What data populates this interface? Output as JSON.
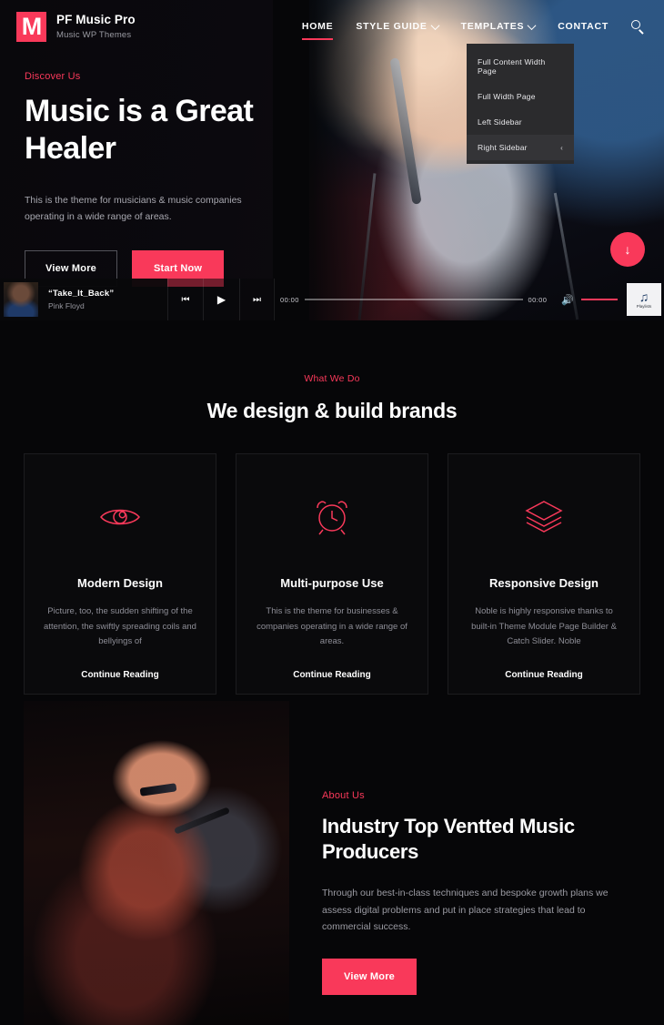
{
  "brand": {
    "logo_letter": "M",
    "title": "PF Music Pro",
    "tagline": "Music WP Themes"
  },
  "nav": {
    "items": [
      {
        "label": "HOME",
        "active": true,
        "caret": false
      },
      {
        "label": "STYLE GUIDE",
        "active": false,
        "caret": true
      },
      {
        "label": "TEMPLATES",
        "active": false,
        "caret": true
      },
      {
        "label": "CONTACT",
        "active": false,
        "caret": false
      }
    ],
    "search_icon": "search-icon"
  },
  "dropdown": {
    "items": [
      {
        "label": "Full Content Width Page",
        "active": false,
        "arrow": ""
      },
      {
        "label": "Full Width Page",
        "active": false,
        "arrow": ""
      },
      {
        "label": "Left Sidebar",
        "active": false,
        "arrow": ""
      },
      {
        "label": "Right Sidebar",
        "active": true,
        "arrow": "‹"
      }
    ]
  },
  "hero": {
    "eyebrow": "Discover Us",
    "title": "Music is a Great Healer",
    "description": "This is the theme for musicians & music companies operating in a wide range of areas.",
    "btn_primary": "Start Now",
    "btn_secondary": "View More",
    "scroll_arrow": "↓"
  },
  "player": {
    "track_title": "“Take_It_Back”",
    "artist": "Pink Floyd",
    "prev_icon": "⏮",
    "play_icon": "▶",
    "next_icon": "⏭",
    "time_current": "00:00",
    "time_total": "00:00",
    "volume_icon": "🔊",
    "playlists_icon": "♫",
    "playlists_label": "Playlists"
  },
  "services": {
    "eyebrow": "What We Do",
    "title": "We design & build brands",
    "cards": [
      {
        "icon": "eye-icon",
        "title": "Modern Design",
        "text": "Picture, too, the sudden shifting of the attention, the swiftly spreading coils and bellyings of",
        "link": "Continue Reading"
      },
      {
        "icon": "alarm-clock-icon",
        "title": "Multi-purpose Use",
        "text": "This is the theme for businesses & companies operating in a wide range of areas.",
        "link": "Continue Reading"
      },
      {
        "icon": "layers-icon",
        "title": "Responsive Design",
        "text": "Noble is highly responsive thanks to built-in Theme Module Page Builder & Catch Slider. Noble",
        "link": "Continue Reading"
      }
    ]
  },
  "about": {
    "eyebrow": "About Us",
    "title": "Industry Top Ventted Music Producers",
    "text": "Through our best-in-class techniques and bespoke growth plans we assess digital problems and put in place strategies that lead to commercial success.",
    "button": "View More"
  },
  "colors": {
    "accent": "#f9395a",
    "background": "#060608",
    "card_border": "#1c1c1f",
    "muted_text": "#9b9ba3"
  }
}
